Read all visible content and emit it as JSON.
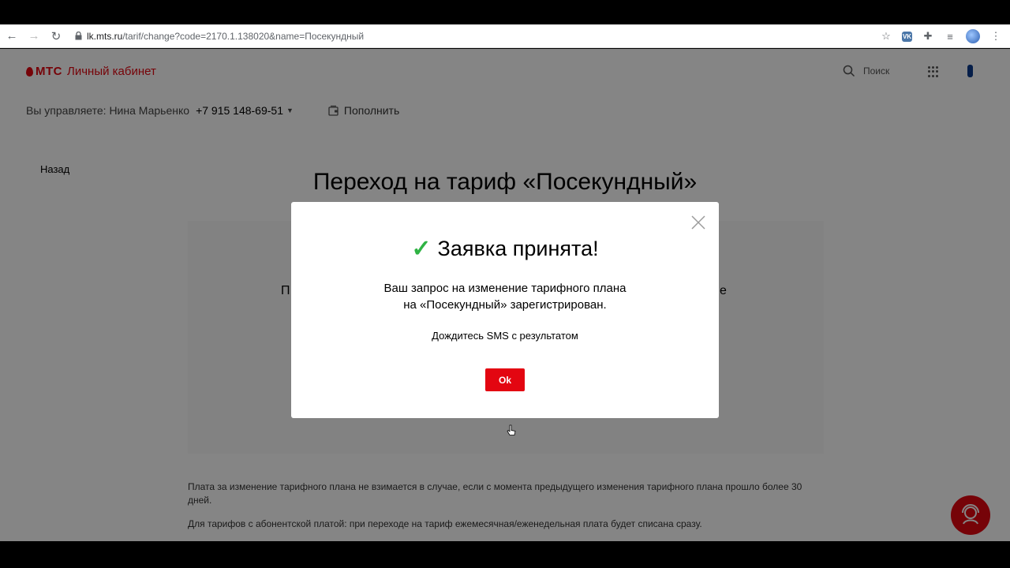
{
  "browser": {
    "url_host": "lk.mts.ru",
    "url_path": "/tarif/change?code=2170.1.138020&name=Посекундный",
    "vk_label": "VK"
  },
  "header": {
    "logo_brand": "МТС",
    "logo_title": "Личный кабинет",
    "search_label": "Поиск"
  },
  "subheader": {
    "manager_label": "Вы управляете: Нина Марьенко",
    "phone": "+7 915 148-69-51",
    "topup_label": "Пополнить"
  },
  "main": {
    "back_label": "Назад",
    "title": "Переход на тариф «Посекундный»",
    "fragment_left": "П",
    "fragment_right": "е",
    "footnote_1": "Плата за изменение тарифного плана не взимается в случае, если с момента предыдущего изменения тарифного плана прошло более 30 дней.",
    "footnote_2": "Для тарифов с абонентской платой: при переходе на тариф ежемесячная/еженедельная плата будет списана сразу."
  },
  "modal": {
    "title": "Заявка принята!",
    "text_line1": "Ваш запрос на изменение тарифного плана",
    "text_line2": "на «Посекундный» зарегистрирован.",
    "note": "Дождитесь SMS с результатом",
    "ok_label": "Ok"
  },
  "colors": {
    "brand_red": "#e30611",
    "check_green": "#2fb344"
  },
  "icons": [
    "back-arrow-icon",
    "forward-arrow-icon",
    "reload-icon",
    "lock-icon",
    "star-icon",
    "extension-icon",
    "playlist-icon",
    "menu-dots-icon",
    "search-icon",
    "apps-grid-icon",
    "wallet-icon",
    "close-icon",
    "checkmark-icon",
    "chat-icon",
    "cursor-icon"
  ]
}
